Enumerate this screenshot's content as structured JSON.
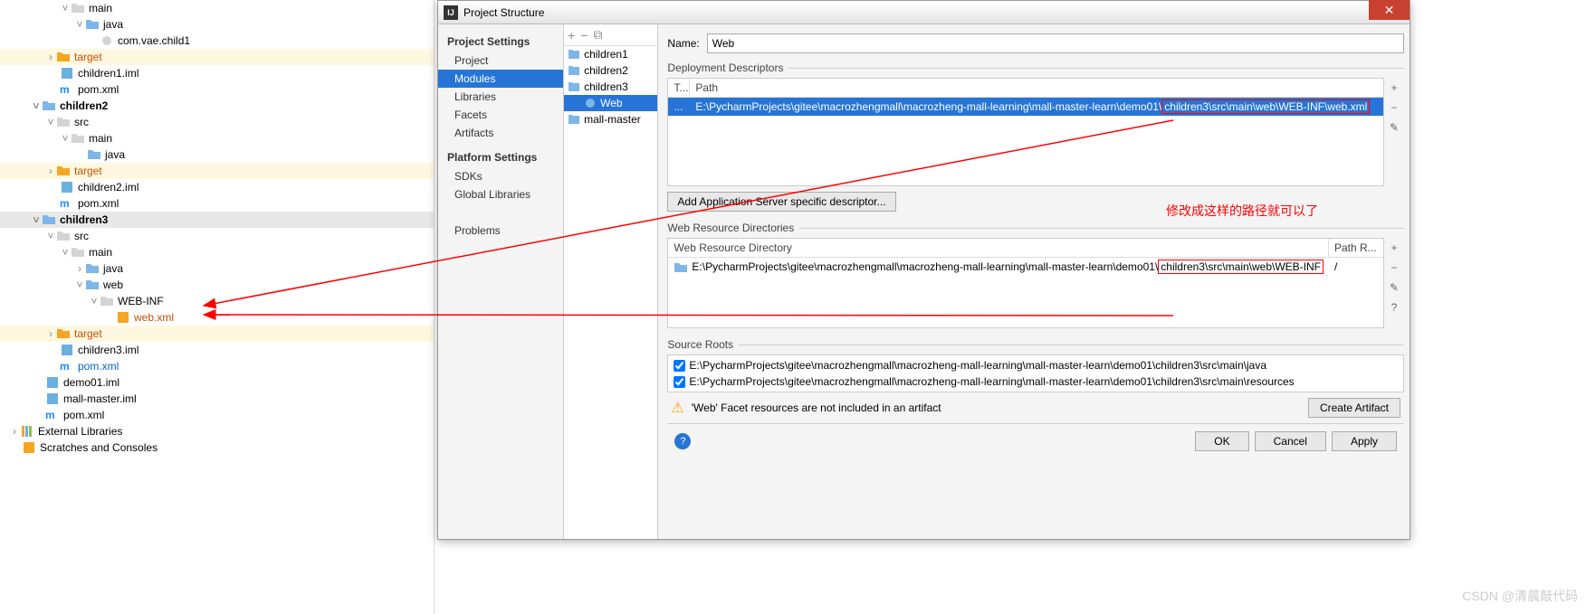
{
  "tree": {
    "main": "main",
    "java": "java",
    "com_vae": "com.vae.child1",
    "target": "target",
    "children1_iml": "children1.iml",
    "pom": "pom.xml",
    "children2": "children2",
    "src": "src",
    "children2_iml": "children2.iml",
    "children3": "children3",
    "web": "web",
    "webinf": "WEB-INF",
    "webxml": "web.xml",
    "children3_iml": "children3.iml",
    "demo01_iml": "demo01.iml",
    "mallmaster_iml": "mall-master.iml",
    "ext_lib": "External Libraries",
    "scratches": "Scratches and Consoles"
  },
  "dialog": {
    "title": "Project Structure",
    "sidebar": {
      "project_settings": "Project Settings",
      "project": "Project",
      "modules": "Modules",
      "libraries": "Libraries",
      "facets": "Facets",
      "artifacts": "Artifacts",
      "platform_settings": "Platform Settings",
      "sdks": "SDKs",
      "global_libs": "Global Libraries",
      "problems": "Problems"
    },
    "modules": {
      "children1": "children1",
      "children2": "children2",
      "children3": "children3",
      "web": "Web",
      "mallmaster": "mall-master"
    },
    "main": {
      "name_label": "Name:",
      "name_value": "Web",
      "deploy_desc": "Deployment Descriptors",
      "th_type": "T...",
      "th_path": "Path",
      "path_prefix": "E:\\PycharmProjects\\gitee\\macrozhengmall\\macrozheng-mall-learning\\mall-master-learn\\demo01\\",
      "path_suffix": "children3\\src\\main\\web\\WEB-INF\\web.xml",
      "td_type": "...",
      "add_server_btn": "Add Application Server specific descriptor...",
      "web_res_dirs": "Web Resource Directories",
      "th_wrd": "Web Resource Directory",
      "th_pathrel": "Path R...",
      "wrd_prefix": "E:\\PycharmProjects\\gitee\\macrozhengmall\\macrozheng-mall-learning\\mall-master-learn\\demo01\\",
      "wrd_suffix": "children3\\src\\main\\web\\WEB-INF",
      "wrd_rel": "/",
      "source_roots": "Source Roots",
      "sr1": "E:\\PycharmProjects\\gitee\\macrozhengmall\\macrozheng-mall-learning\\mall-master-learn\\demo01\\children3\\src\\main\\java",
      "sr2": "E:\\PycharmProjects\\gitee\\macrozhengmall\\macrozheng-mall-learning\\mall-master-learn\\demo01\\children3\\src\\main\\resources",
      "warning": "'Web' Facet resources are not included in an artifact",
      "create_artifact": "Create Artifact",
      "ok": "OK",
      "cancel": "Cancel",
      "apply": "Apply"
    },
    "annotation": "修改成这样的路径就可以了",
    "watermark": "CSDN @清晨敲代码"
  }
}
